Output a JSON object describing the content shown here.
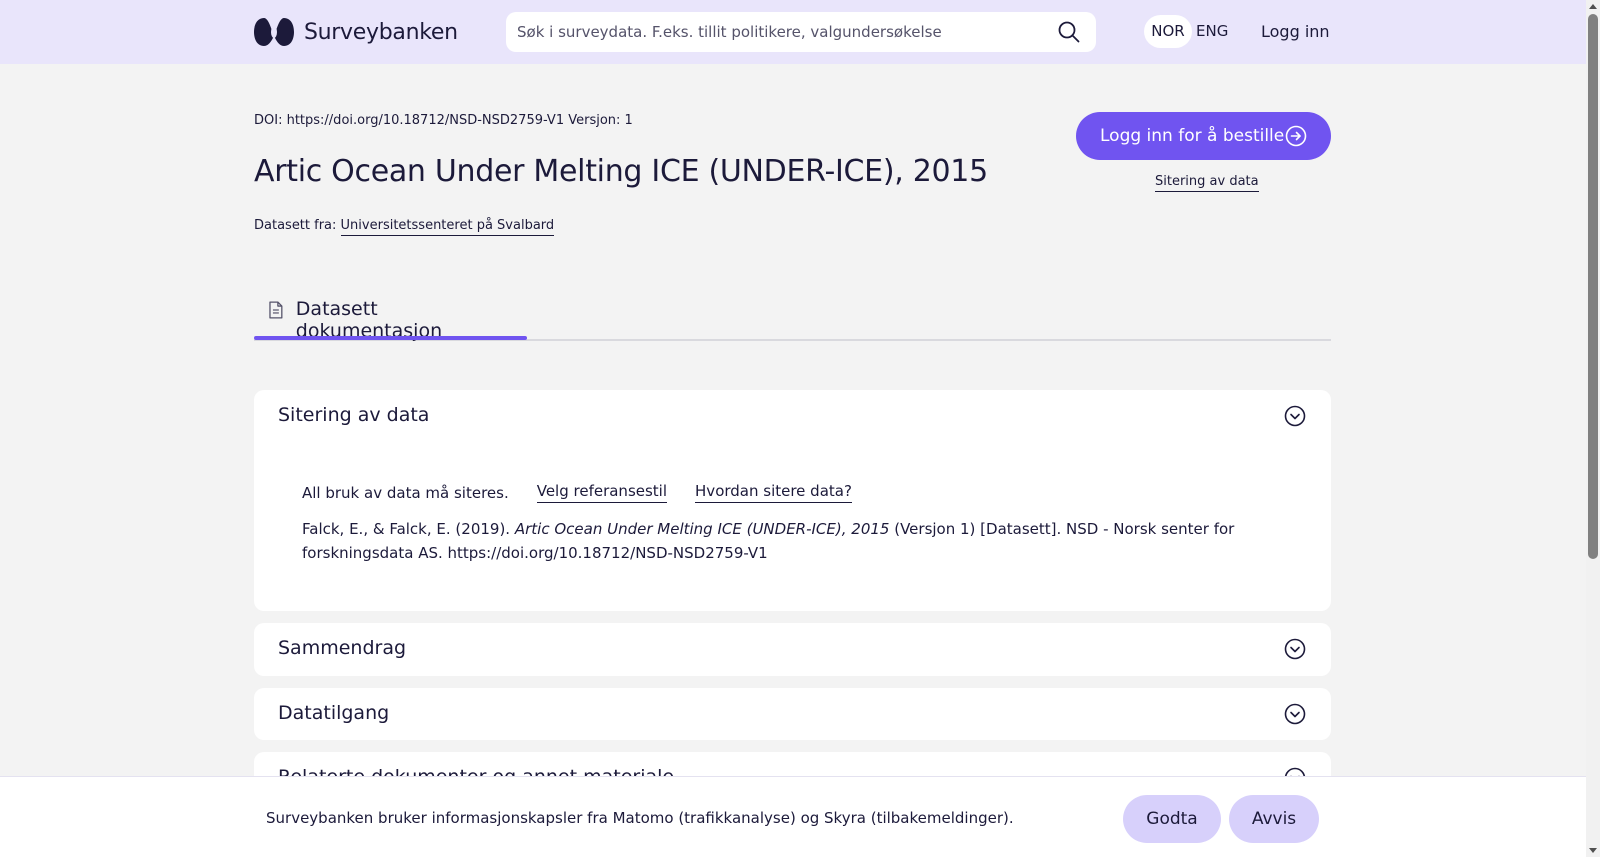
{
  "header": {
    "logo_text": "Surveybanken",
    "search_placeholder": "Søk i surveydata. F.eks. tillit politikere, valgundersøkelse",
    "lang_nor": "NOR",
    "lang_eng": "ENG",
    "login": "Logg inn"
  },
  "dataset": {
    "doi_line": "DOI: https://doi.org/10.18712/NSD-NSD2759-V1 Versjon: 1",
    "title": "Artic Ocean Under Melting ICE (UNDER-ICE), 2015",
    "from_label": "Datasett fra:",
    "from_org": "Universitetssenteret på Svalbard",
    "order_button": "Logg inn for å bestille",
    "citation_link": "Sitering av data"
  },
  "tabs": [
    {
      "label": "Datasett dokumentasjon"
    }
  ],
  "accordions": [
    {
      "title": "Sitering av data"
    },
    {
      "title": "Sammendrag"
    },
    {
      "title": "Datatilgang"
    },
    {
      "title": "Relaterte dokumenter og annet materiale"
    }
  ],
  "citation": {
    "intro": "All bruk av data må siteres.",
    "style_link": "Velg referansestil",
    "howto_link": "Hvordan sitere data?",
    "authors": "Falck, E., & Falck, E. (2019).",
    "work_title": "Artic Ocean Under Melting ICE (UNDER-ICE), 2015",
    "rest": "(Versjon 1) [Datasett]. NSD - Norsk senter for forskningsdata AS. https://doi.org/10.18712/NSD-NSD2759-V1"
  },
  "cookie": {
    "text": "Surveybanken bruker informasjonskapsler fra Matomo (trafikkanalyse) og Skyra (tilbakemeldinger).",
    "accept": "Godta",
    "reject": "Avvis"
  },
  "colors": {
    "accent": "#7054f0",
    "header_bg": "#e9e5fb",
    "button_light": "#d7d0fb"
  }
}
